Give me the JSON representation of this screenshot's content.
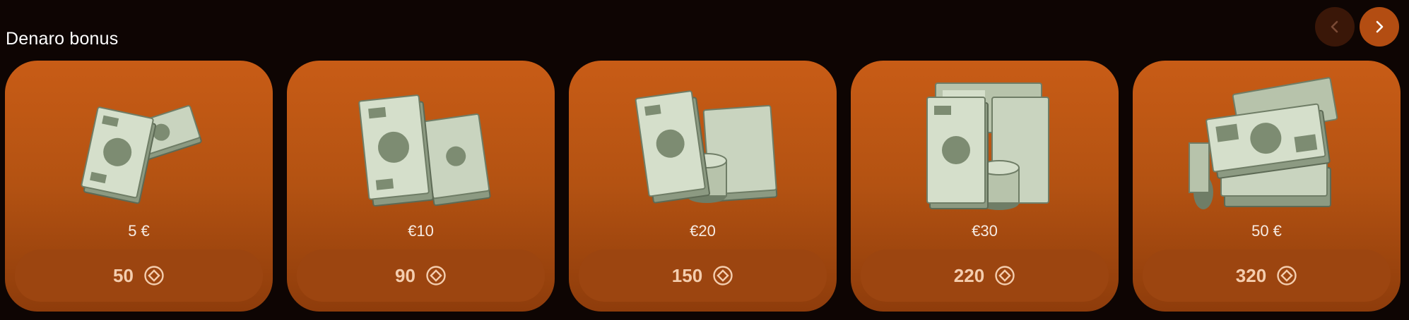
{
  "section": {
    "title": "Denaro bonus"
  },
  "nav": {
    "prev_icon": "chevron-left-icon",
    "next_icon": "chevron-right-icon"
  },
  "colors": {
    "background": "#0e0503",
    "card": "#c85c16",
    "button": "#9c4510",
    "button_text": "#f4cdae"
  },
  "cards": [
    {
      "image": "cash-stack-small",
      "price": "5 €",
      "cost": "50",
      "cost_icon": "coin-icon"
    },
    {
      "image": "cash-stack-medium",
      "price": "€10",
      "cost": "90",
      "cost_icon": "coin-icon"
    },
    {
      "image": "cash-stack-roll",
      "price": "€20",
      "cost": "150",
      "cost_icon": "coin-icon"
    },
    {
      "image": "cash-stack-large",
      "price": "€30",
      "cost": "220",
      "cost_icon": "coin-icon"
    },
    {
      "image": "cash-pile",
      "price": "50 €",
      "cost": "320",
      "cost_icon": "coin-icon"
    }
  ]
}
